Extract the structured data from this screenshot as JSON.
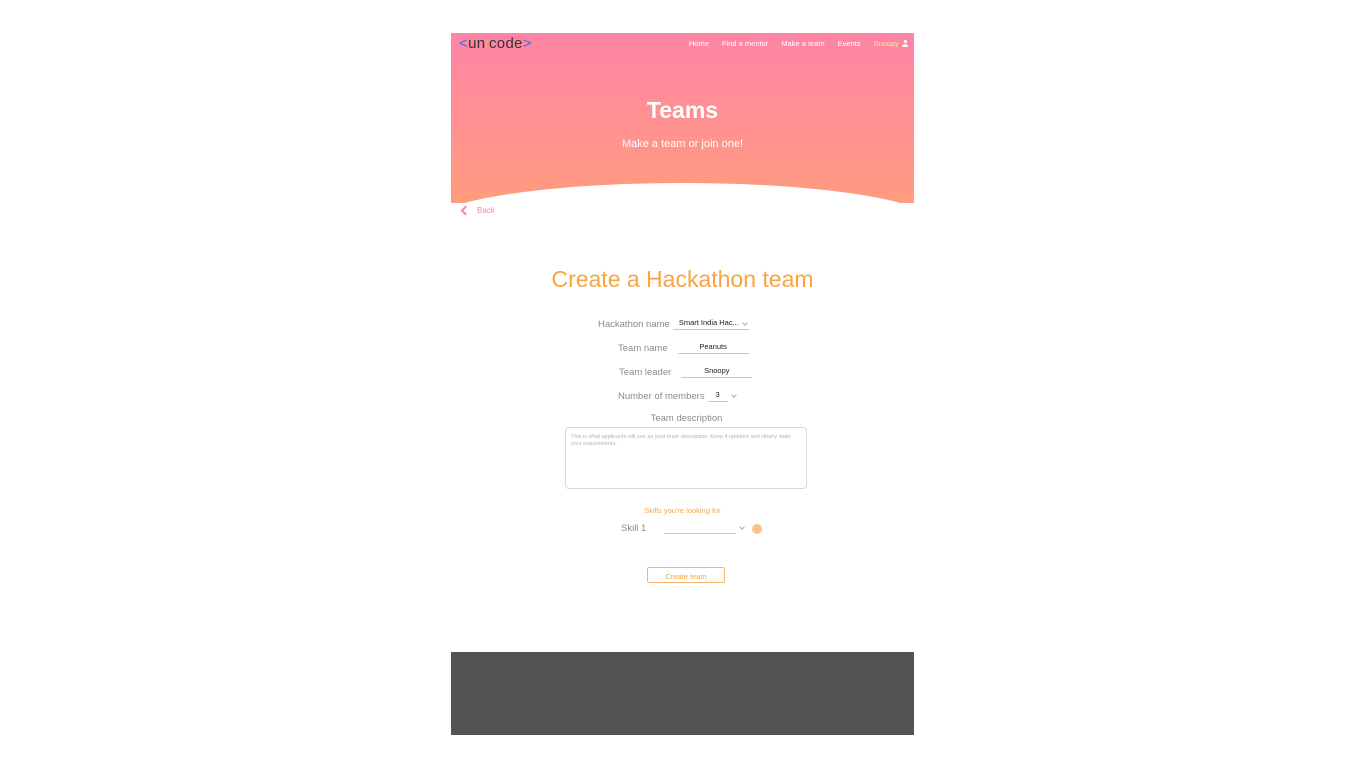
{
  "brand": {
    "open": "<",
    "name_pre": "un",
    "name_dot": "i",
    "name_post": "code",
    "close": ">"
  },
  "nav": {
    "items": [
      "Home",
      "Find a mentor",
      "Make a team",
      "Events"
    ],
    "user": "Snoopy",
    "user_icon": "user-icon"
  },
  "hero": {
    "title": "Teams",
    "subtitle": "Make a team or join one!"
  },
  "back": {
    "label": "Back",
    "icon": "chevron-left-icon"
  },
  "form": {
    "title": "Create a Hackathon team",
    "hackathon_label": "Hackathon name",
    "hackathon_value": "Smart India Hac...",
    "team_name_label": "Team name",
    "team_name_value": "Peanuts",
    "team_leader_label": "Team leader",
    "team_leader_value": "Snoopy",
    "members_label": "Number of members",
    "members_value": "3",
    "description_label": "Team description",
    "description_placeholder": "This is what applicants will see as your team description. Keep it updated and clearly state your requirements.",
    "skills_label": "Skills you're looking for",
    "skill_1_label": "Skill 1",
    "skill_1_value": "",
    "submit_label": "Create team"
  },
  "colors": {
    "hero_top": "#ff84a6",
    "hero_bottom": "#ff9c7e",
    "accent": "#f8a541",
    "footer": "#535353"
  }
}
